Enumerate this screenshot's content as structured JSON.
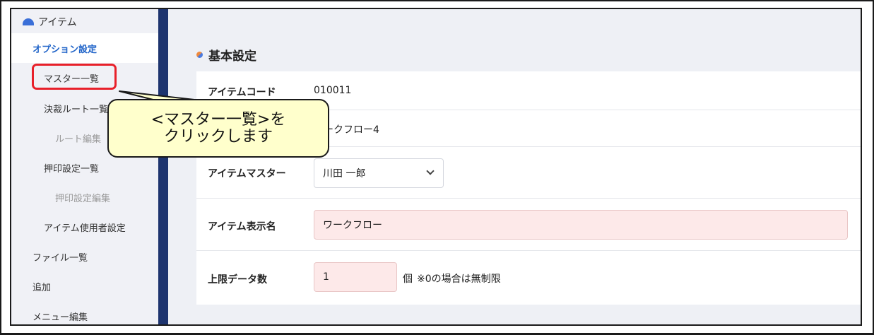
{
  "sidebar": {
    "header": "アイテム",
    "items": [
      {
        "label": "オプション設定"
      },
      {
        "label": "マスター一覧"
      },
      {
        "label": "決裁ルート一覧"
      },
      {
        "label": "ルート編集"
      },
      {
        "label": "押印設定一覧"
      },
      {
        "label": "押印設定編集"
      },
      {
        "label": "アイテム使用者設定"
      },
      {
        "label": "ファイル一覧"
      },
      {
        "label": "追加"
      },
      {
        "label": "メニュー編集"
      }
    ]
  },
  "main": {
    "section_title": "基本設定",
    "fields": {
      "item_code": {
        "label": "アイテムコード",
        "value": "010011"
      },
      "item_name": {
        "value": "ワークフロー4"
      },
      "item_master": {
        "label": "アイテムマスター",
        "value": "川田 一郎"
      },
      "display_name": {
        "label": "アイテム表示名",
        "value": "ワークフロー"
      },
      "data_limit": {
        "label": "上限データ数",
        "value": "1",
        "unit": "個",
        "note": "※0の場合は無制限"
      }
    }
  },
  "callout": {
    "line1": "<マスター一覧>を",
    "line2": "クリックします"
  },
  "colors": {
    "sidebar_bar": "#1e356f",
    "active_link": "#1f63c8",
    "highlight": "#e8202a",
    "callout_bg": "#ffffcc",
    "pink_input": "#fde9e9"
  }
}
